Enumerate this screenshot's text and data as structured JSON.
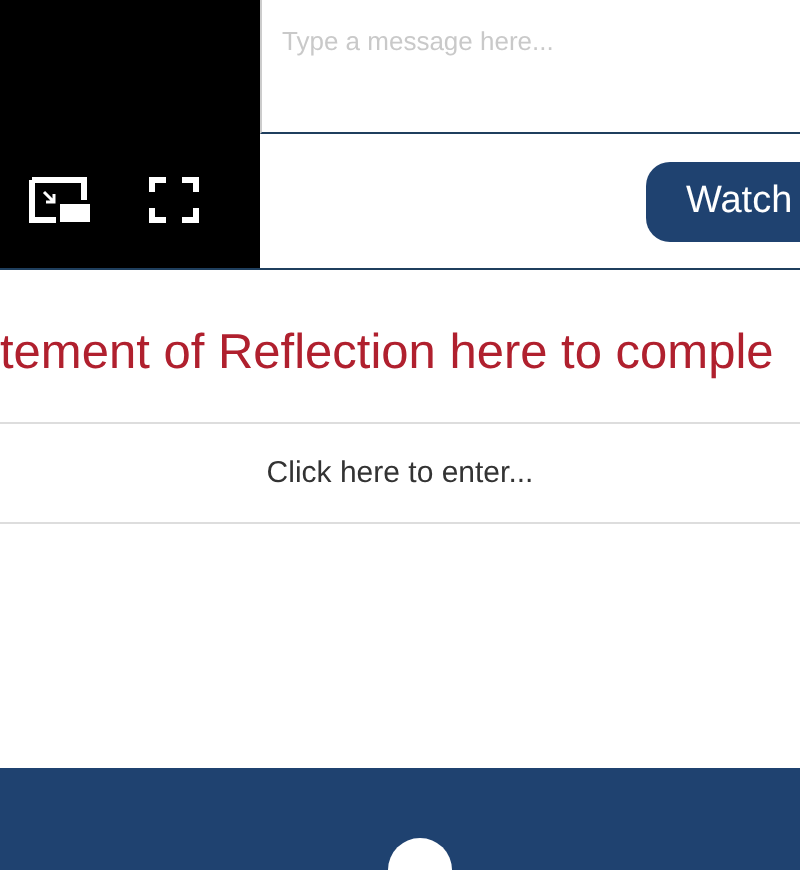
{
  "chat": {
    "placeholder": "Type a message here..."
  },
  "watch_button": {
    "label": "Watch"
  },
  "reflection_prompt": "tement of Reflection here to comple",
  "entry": {
    "placeholder": "Click here to enter..."
  }
}
